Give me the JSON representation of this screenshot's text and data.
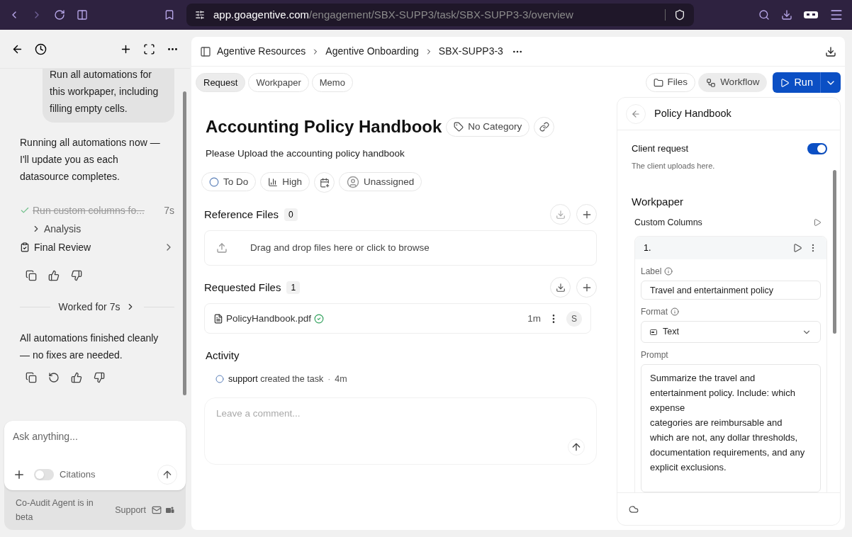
{
  "browser": {
    "url_host": "app.goagentive.com",
    "url_path": "/engagement/SBX-SUPP3/task/SBX-SUPP3-3/overview"
  },
  "chat": {
    "user_message": "Run all automations for this workpaper, including filling empty cells.",
    "reply": "Running all automations now — I'll update you as each datasource completes.",
    "steps": [
      {
        "text": "Run custom columns fo...",
        "done": true,
        "time": "7s"
      }
    ],
    "substep": "Analysis",
    "review": "Final Review",
    "worked": "Worked for 7s",
    "final_message": "All automations finished cleanly — no fixes are needed.",
    "composer": {
      "placeholder": "Ask anything...",
      "citations_label": "Citations",
      "citations_on": false
    },
    "footer": {
      "beta_note": "Co-Audit Agent is in beta",
      "support": "Support"
    }
  },
  "breadcrumb": [
    "Agentive Resources",
    "Agentive Onboarding",
    "SBX-SUPP3-3"
  ],
  "tabs": [
    {
      "label": "Request",
      "selected": true
    },
    {
      "label": "Workpaper",
      "selected": false
    },
    {
      "label": "Memo",
      "selected": false
    }
  ],
  "actions": {
    "files": "Files",
    "workflow": "Workflow",
    "run": "Run"
  },
  "task": {
    "title": "Accounting Policy Handbook",
    "category": "No Category",
    "description": "Please Upload the accounting policy handbook",
    "status": "To Do",
    "priority": "High",
    "assignee": "Unassigned"
  },
  "reference_files": {
    "title": "Reference Files",
    "count": "0",
    "dropzone": "Drag and drop files here or click to browse"
  },
  "requested_files": {
    "title": "Requested Files",
    "count": "1",
    "files": [
      {
        "name": "PolicyHandbook.pdf",
        "verified": true,
        "time": "1m",
        "avatar": "S"
      }
    ]
  },
  "activity": {
    "title": "Activity",
    "entries": [
      {
        "user": "support",
        "action": "created the task",
        "separator": "·",
        "time": "4m"
      }
    ],
    "comment_placeholder": "Leave a comment..."
  },
  "panel": {
    "title": "Policy Handbook",
    "client_request": {
      "label": "Client request",
      "on": true,
      "hint": "The client uploads here."
    },
    "workpaper_title": "Workpaper",
    "custom_columns": "Custom Columns",
    "column": {
      "number": "1.",
      "label_caption": "Label",
      "label_value": "Travel and entertainment policy",
      "format_caption": "Format",
      "format_value": "Text",
      "prompt_caption": "Prompt",
      "prompt_value": "Summarize the travel and entertainment policy. Include: which expense\ncategories are reimbursable and which are not, any dollar thresholds,\ndocumentation requirements, and any explicit exclusions."
    }
  }
}
